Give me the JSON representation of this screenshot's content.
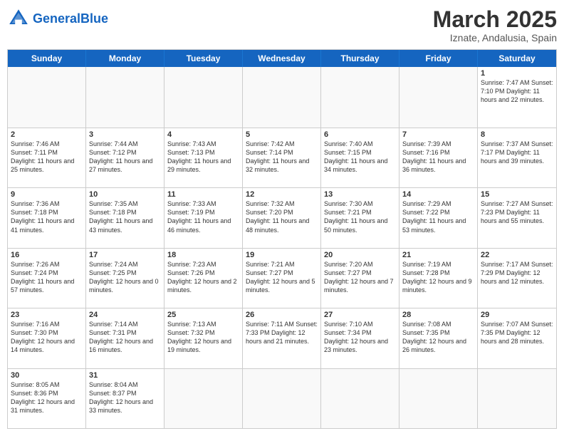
{
  "header": {
    "logo_general": "General",
    "logo_blue": "Blue",
    "month_title": "March 2025",
    "subtitle": "Iznate, Andalusia, Spain"
  },
  "days_of_week": [
    "Sunday",
    "Monday",
    "Tuesday",
    "Wednesday",
    "Thursday",
    "Friday",
    "Saturday"
  ],
  "weeks": [
    [
      {
        "day": "",
        "info": ""
      },
      {
        "day": "",
        "info": ""
      },
      {
        "day": "",
        "info": ""
      },
      {
        "day": "",
        "info": ""
      },
      {
        "day": "",
        "info": ""
      },
      {
        "day": "",
        "info": ""
      },
      {
        "day": "1",
        "info": "Sunrise: 7:47 AM\nSunset: 7:10 PM\nDaylight: 11 hours\nand 22 minutes."
      }
    ],
    [
      {
        "day": "2",
        "info": "Sunrise: 7:46 AM\nSunset: 7:11 PM\nDaylight: 11 hours\nand 25 minutes."
      },
      {
        "day": "3",
        "info": "Sunrise: 7:44 AM\nSunset: 7:12 PM\nDaylight: 11 hours\nand 27 minutes."
      },
      {
        "day": "4",
        "info": "Sunrise: 7:43 AM\nSunset: 7:13 PM\nDaylight: 11 hours\nand 29 minutes."
      },
      {
        "day": "5",
        "info": "Sunrise: 7:42 AM\nSunset: 7:14 PM\nDaylight: 11 hours\nand 32 minutes."
      },
      {
        "day": "6",
        "info": "Sunrise: 7:40 AM\nSunset: 7:15 PM\nDaylight: 11 hours\nand 34 minutes."
      },
      {
        "day": "7",
        "info": "Sunrise: 7:39 AM\nSunset: 7:16 PM\nDaylight: 11 hours\nand 36 minutes."
      },
      {
        "day": "8",
        "info": "Sunrise: 7:37 AM\nSunset: 7:17 PM\nDaylight: 11 hours\nand 39 minutes."
      }
    ],
    [
      {
        "day": "9",
        "info": "Sunrise: 7:36 AM\nSunset: 7:18 PM\nDaylight: 11 hours\nand 41 minutes."
      },
      {
        "day": "10",
        "info": "Sunrise: 7:35 AM\nSunset: 7:18 PM\nDaylight: 11 hours\nand 43 minutes."
      },
      {
        "day": "11",
        "info": "Sunrise: 7:33 AM\nSunset: 7:19 PM\nDaylight: 11 hours\nand 46 minutes."
      },
      {
        "day": "12",
        "info": "Sunrise: 7:32 AM\nSunset: 7:20 PM\nDaylight: 11 hours\nand 48 minutes."
      },
      {
        "day": "13",
        "info": "Sunrise: 7:30 AM\nSunset: 7:21 PM\nDaylight: 11 hours\nand 50 minutes."
      },
      {
        "day": "14",
        "info": "Sunrise: 7:29 AM\nSunset: 7:22 PM\nDaylight: 11 hours\nand 53 minutes."
      },
      {
        "day": "15",
        "info": "Sunrise: 7:27 AM\nSunset: 7:23 PM\nDaylight: 11 hours\nand 55 minutes."
      }
    ],
    [
      {
        "day": "16",
        "info": "Sunrise: 7:26 AM\nSunset: 7:24 PM\nDaylight: 11 hours\nand 57 minutes."
      },
      {
        "day": "17",
        "info": "Sunrise: 7:24 AM\nSunset: 7:25 PM\nDaylight: 12 hours\nand 0 minutes."
      },
      {
        "day": "18",
        "info": "Sunrise: 7:23 AM\nSunset: 7:26 PM\nDaylight: 12 hours\nand 2 minutes."
      },
      {
        "day": "19",
        "info": "Sunrise: 7:21 AM\nSunset: 7:27 PM\nDaylight: 12 hours\nand 5 minutes."
      },
      {
        "day": "20",
        "info": "Sunrise: 7:20 AM\nSunset: 7:27 PM\nDaylight: 12 hours\nand 7 minutes."
      },
      {
        "day": "21",
        "info": "Sunrise: 7:19 AM\nSunset: 7:28 PM\nDaylight: 12 hours\nand 9 minutes."
      },
      {
        "day": "22",
        "info": "Sunrise: 7:17 AM\nSunset: 7:29 PM\nDaylight: 12 hours\nand 12 minutes."
      }
    ],
    [
      {
        "day": "23",
        "info": "Sunrise: 7:16 AM\nSunset: 7:30 PM\nDaylight: 12 hours\nand 14 minutes."
      },
      {
        "day": "24",
        "info": "Sunrise: 7:14 AM\nSunset: 7:31 PM\nDaylight: 12 hours\nand 16 minutes."
      },
      {
        "day": "25",
        "info": "Sunrise: 7:13 AM\nSunset: 7:32 PM\nDaylight: 12 hours\nand 19 minutes."
      },
      {
        "day": "26",
        "info": "Sunrise: 7:11 AM\nSunset: 7:33 PM\nDaylight: 12 hours\nand 21 minutes."
      },
      {
        "day": "27",
        "info": "Sunrise: 7:10 AM\nSunset: 7:34 PM\nDaylight: 12 hours\nand 23 minutes."
      },
      {
        "day": "28",
        "info": "Sunrise: 7:08 AM\nSunset: 7:35 PM\nDaylight: 12 hours\nand 26 minutes."
      },
      {
        "day": "29",
        "info": "Sunrise: 7:07 AM\nSunset: 7:35 PM\nDaylight: 12 hours\nand 28 minutes."
      }
    ],
    [
      {
        "day": "30",
        "info": "Sunrise: 8:05 AM\nSunset: 8:36 PM\nDaylight: 12 hours\nand 31 minutes."
      },
      {
        "day": "31",
        "info": "Sunrise: 8:04 AM\nSunset: 8:37 PM\nDaylight: 12 hours\nand 33 minutes."
      },
      {
        "day": "",
        "info": ""
      },
      {
        "day": "",
        "info": ""
      },
      {
        "day": "",
        "info": ""
      },
      {
        "day": "",
        "info": ""
      },
      {
        "day": "",
        "info": ""
      }
    ]
  ]
}
